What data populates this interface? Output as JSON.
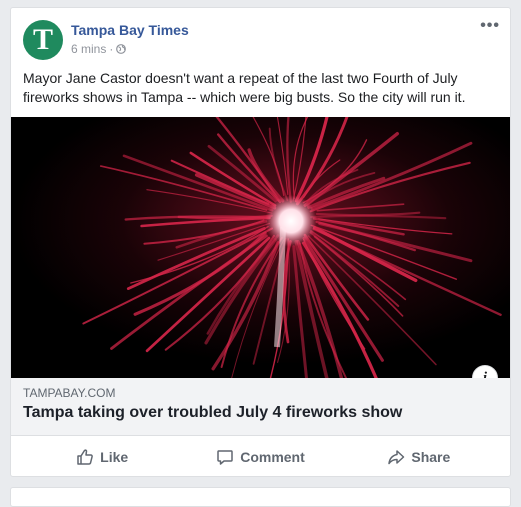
{
  "post": {
    "page_name": "Tampa Bay Times",
    "avatar_letter": "T",
    "time": "6 mins",
    "separator": "·",
    "privacy_icon": "globe-icon",
    "more_label": "•••",
    "text": "Mayor Jane Castor doesn't want a repeat of the last two Fourth of July fireworks shows in Tampa -- which were big busts. So the city will run it."
  },
  "link": {
    "domain": "TAMPABAY.COM",
    "title": "Tampa taking over troubled July 4 fireworks show",
    "info_label": "i"
  },
  "actions": {
    "like": "Like",
    "comment": "Comment",
    "share": "Share"
  },
  "colors": {
    "brand_green": "#1f8a5e",
    "page_name_blue": "#365899",
    "firework_red": "#d8264a"
  }
}
